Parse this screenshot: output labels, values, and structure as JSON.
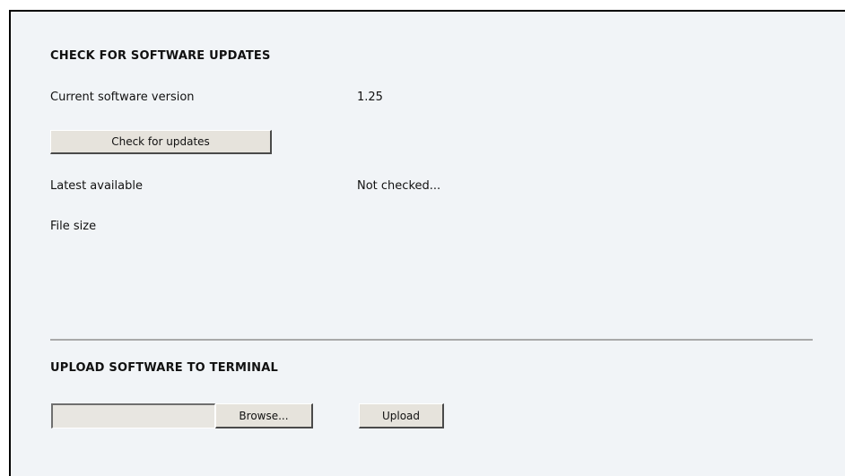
{
  "check_section": {
    "heading": "CHECK FOR SOFTWARE UPDATES",
    "current_version_label": "Current software version",
    "current_version_value": "1.25",
    "check_button_label": "Check for updates",
    "latest_label": "Latest available",
    "latest_value": "Not checked...",
    "file_size_label": "File size",
    "file_size_value": ""
  },
  "upload_section": {
    "heading": "UPLOAD SOFTWARE TO TERMINAL",
    "file_input_value": "",
    "browse_button_label": "Browse...",
    "upload_button_label": "Upload"
  }
}
